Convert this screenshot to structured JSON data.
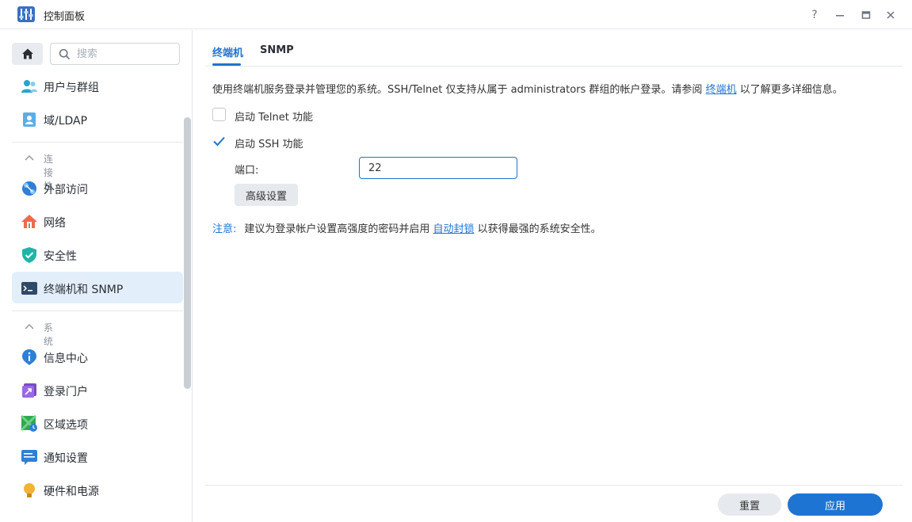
{
  "window": {
    "title": "控制面板",
    "controls": [
      "?",
      "—",
      "▭",
      "✕"
    ]
  },
  "sidebar": {
    "search_placeholder": "搜索",
    "items": [
      {
        "label": "用户与群组",
        "icon": "users-icon"
      },
      {
        "label": "域/LDAP",
        "icon": "domain-ldap-icon"
      },
      {
        "label": "外部访问",
        "icon": "external-access-icon"
      },
      {
        "label": "网络",
        "icon": "network-home-icon"
      },
      {
        "label": "安全性",
        "icon": "security-shield-icon"
      },
      {
        "label": "终端机和 SNMP",
        "icon": "terminal-icon"
      },
      {
        "label": "信息中心",
        "icon": "info-center-icon"
      },
      {
        "label": "登录门户",
        "icon": "login-portal-icon"
      },
      {
        "label": "区域选项",
        "icon": "regional-options-icon"
      },
      {
        "label": "通知设置",
        "icon": "notification-icon"
      },
      {
        "label": "硬件和电源",
        "icon": "hardware-power-icon"
      }
    ],
    "sections": {
      "connectivity": "连接性",
      "system": "系统"
    }
  },
  "tabs": [
    {
      "label": "终端机",
      "active": true
    },
    {
      "label": "SNMP",
      "active": false
    }
  ],
  "content": {
    "description_before": "使用终端机服务登录并管理您的系统。SSH/Telnet 仅支持从属于 administrators 群组的帐户登录。请参阅 ",
    "description_link": "终端机",
    "description_after": " 以了解更多详细信息。",
    "telnet_label": "启动 Telnet 功能",
    "telnet_checked": false,
    "ssh_label": "启动 SSH 功能",
    "ssh_checked": true,
    "port_label": "端口:",
    "port_value": "22",
    "advanced_button": "高级设置",
    "note_label": "注意:",
    "note_before": "建议为登录帐户设置高强度的密码并启用 ",
    "note_link": "自动封锁",
    "note_after": " 以获得最强的系统安全性。"
  },
  "footer": {
    "reset_label": "重置",
    "apply_label": "应用"
  },
  "colors": {
    "accent": "#1e74d2",
    "active_bg": "#e3eefb"
  }
}
